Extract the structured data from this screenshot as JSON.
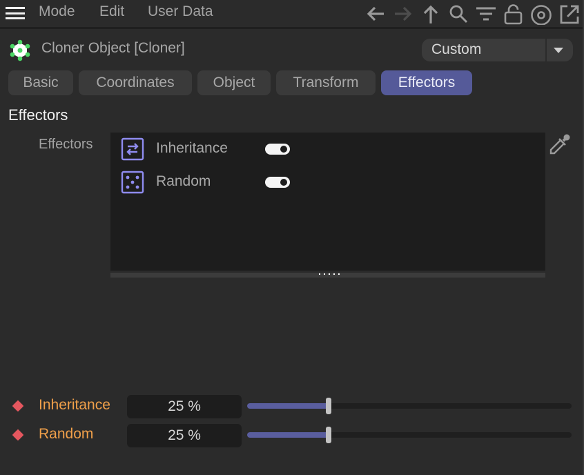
{
  "menubar": {
    "items": [
      "Mode",
      "Edit",
      "User Data"
    ],
    "toolbar_icons": [
      "back-arrow-icon",
      "forward-arrow-icon",
      "up-arrow-icon",
      "search-icon",
      "filter-icon",
      "lock-icon",
      "target-icon",
      "open-external-icon"
    ]
  },
  "header": {
    "object_title": "Cloner Object [Cloner]",
    "object_icon": "cloner-icon",
    "mode_dropdown": {
      "selected": "Custom"
    }
  },
  "tabs": [
    {
      "label": "Basic",
      "active": false
    },
    {
      "label": "Coordinates",
      "active": false
    },
    {
      "label": "Object",
      "active": false
    },
    {
      "label": "Transform",
      "active": false
    },
    {
      "label": "Effectors",
      "active": true
    }
  ],
  "section": {
    "title": "Effectors",
    "field_label": "Effectors",
    "effectors": [
      {
        "name": "Inheritance",
        "icon": "inheritance-icon",
        "enabled": true
      },
      {
        "name": "Random",
        "icon": "random-dice-icon",
        "enabled": true
      }
    ]
  },
  "parameters": [
    {
      "label": "Inheritance",
      "value_text": "25 %",
      "value": 0.25
    },
    {
      "label": "Random",
      "value_text": "25 %",
      "value": 0.25
    }
  ],
  "colors": {
    "accent": "#555a99",
    "param_label": "#f1a04a",
    "keyframe": "#e5575f",
    "effector_icon": "#8f8cf0",
    "cloner_icon": "#4bd865"
  }
}
